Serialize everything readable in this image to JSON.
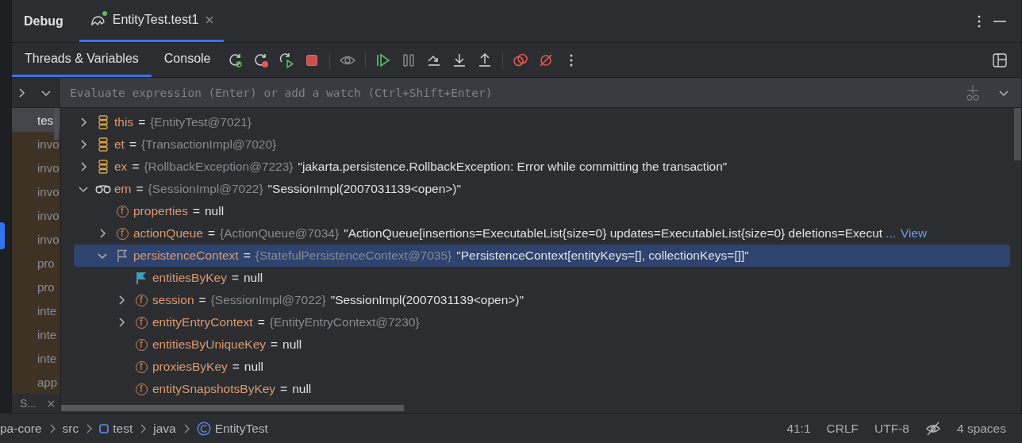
{
  "tool_window": {
    "title": "Debug",
    "tabs": [
      {
        "label": "EntityTest.test1",
        "selected": true,
        "running": true
      }
    ]
  },
  "sub_tabs": [
    {
      "label": "Threads & Variables",
      "selected": true
    },
    {
      "label": "Console",
      "selected": false
    }
  ],
  "toolbar": [
    {
      "kind": "rerun",
      "disabled": false
    },
    {
      "kind": "rerun-failed",
      "disabled": false
    },
    {
      "kind": "rerun-toggle",
      "disabled": false
    },
    {
      "kind": "stop",
      "disabled": false
    },
    {
      "kind": "separator"
    },
    {
      "kind": "watch",
      "disabled": true
    },
    {
      "kind": "separator"
    },
    {
      "kind": "resume",
      "disabled": false
    },
    {
      "kind": "pause",
      "disabled": true
    },
    {
      "kind": "step-over",
      "disabled": false
    },
    {
      "kind": "step-into",
      "disabled": false
    },
    {
      "kind": "step-out",
      "disabled": false
    },
    {
      "kind": "separator"
    },
    {
      "kind": "breakpoints",
      "disabled": false
    },
    {
      "kind": "mute",
      "disabled": false
    },
    {
      "kind": "more",
      "disabled": false
    }
  ],
  "evaluate": {
    "placeholder": "Evaluate expression (Enter) or add a watch (Ctrl+Shift+Enter)"
  },
  "frames": {
    "items": [
      {
        "label": "tes",
        "selected": true,
        "library": false
      },
      {
        "label": "invo",
        "selected": false,
        "library": true
      },
      {
        "label": "invo",
        "selected": false,
        "library": true
      },
      {
        "label": "invo",
        "selected": false,
        "library": true
      },
      {
        "label": "invo",
        "selected": false,
        "library": true
      },
      {
        "label": "invo",
        "selected": false,
        "library": true
      },
      {
        "label": "pro",
        "selected": false,
        "library": true
      },
      {
        "label": "pro",
        "selected": false,
        "library": true
      },
      {
        "label": "inte",
        "selected": false,
        "library": true
      },
      {
        "label": "inte",
        "selected": false,
        "library": true
      },
      {
        "label": "inte",
        "selected": false,
        "library": true
      },
      {
        "label": "app",
        "selected": false,
        "library": true
      }
    ],
    "footer": "S..."
  },
  "variables": [
    {
      "kind": "local",
      "name": "this",
      "operator": "=",
      "type": "{EntityTest@7021}",
      "expanded": false,
      "selected": false
    },
    {
      "kind": "local",
      "name": "et",
      "operator": "=",
      "type": "{TransactionImpl@7020}",
      "expanded": false,
      "selected": false
    },
    {
      "kind": "local",
      "name": "ex",
      "operator": "=",
      "type": "{RollbackException@7223}",
      "value": "\"jakarta.persistence.RollbackException: Error while committing the transaction\"",
      "expanded": false,
      "selected": false
    },
    {
      "kind": "watch",
      "name": "em",
      "operator": "=",
      "type": "{SessionImpl@7022}",
      "value": "\"SessionImpl(2007031139<open>)\"",
      "expanded": true,
      "selected": false,
      "children": [
        {
          "kind": "field",
          "icon_text": "f",
          "name": "properties",
          "operator": "=",
          "value": "null",
          "selected": false
        },
        {
          "kind": "field",
          "icon_text": "f",
          "name": "actionQueue",
          "operator": "=",
          "type": "{ActionQueue@7034}",
          "value": "\"ActionQueue[insertions=ExecutableList{size=0} updates=ExecutableList{size=0} deletions=Execut",
          "ellipsis": "...",
          "link": "View",
          "expanded": false,
          "selected": false
        },
        {
          "kind": "marker",
          "name": "persistenceContext",
          "operator": "=",
          "type": "{StatefulPersistenceContext@7035}",
          "value": "\"PersistenceContext[entityKeys=[], collectionKeys=[]]\"",
          "expanded": true,
          "selected": true,
          "children": [
            {
              "kind": "flag",
              "name": "entitiesByKey",
              "operator": "=",
              "value": "null",
              "selected": false
            },
            {
              "kind": "field",
              "icon_text": "f",
              "name": "session",
              "operator": "=",
              "type": "{SessionImpl@7022}",
              "value": "\"SessionImpl(2007031139<open>)\"",
              "expanded": false,
              "selected": false
            },
            {
              "kind": "field",
              "icon_text": "f",
              "name": "entityEntryContext",
              "operator": "=",
              "type": "{EntityEntryContext@7230}",
              "expanded": false,
              "selected": false
            },
            {
              "kind": "field",
              "icon_text": "f",
              "name": "entitiesByUniqueKey",
              "operator": "=",
              "value": "null",
              "selected": false
            },
            {
              "kind": "field",
              "icon_text": "f",
              "name": "proxiesByKey",
              "operator": "=",
              "value": "null",
              "selected": false
            },
            {
              "kind": "field",
              "icon_text": "f",
              "name": "entitySnapshotsByKey",
              "operator": "=",
              "value": "null",
              "selected": false
            }
          ]
        }
      ]
    }
  ],
  "status_bar": {
    "breadcrumbs": [
      {
        "kind": "plain",
        "label": "pa-core"
      },
      {
        "kind": "plain",
        "label": "src"
      },
      {
        "kind": "module",
        "label": "test"
      },
      {
        "kind": "plain",
        "label": "java"
      },
      {
        "kind": "class",
        "label": "EntityTest"
      }
    ],
    "items": [
      {
        "kind": "text",
        "label": "41:1"
      },
      {
        "kind": "text",
        "label": "CRLF"
      },
      {
        "kind": "text",
        "label": "UTF-8"
      },
      {
        "kind": "icon"
      },
      {
        "kind": "text",
        "label": "4 spaces"
      }
    ]
  }
}
